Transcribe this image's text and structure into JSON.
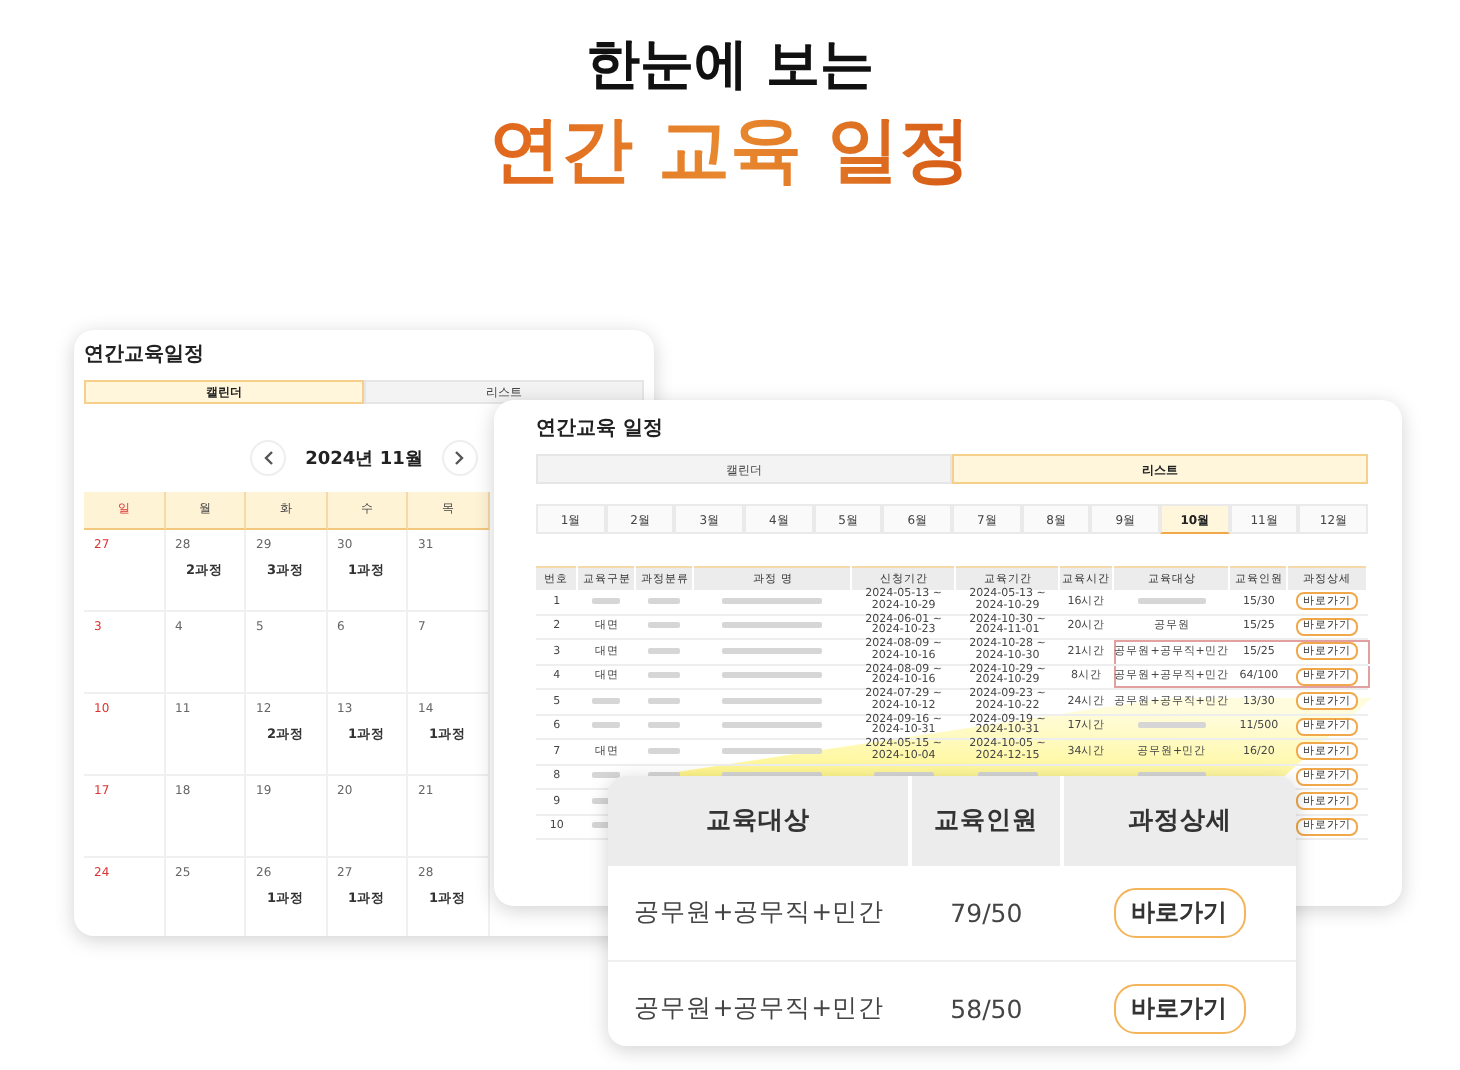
{
  "headline": {
    "line1": "한눈에 보는",
    "line2": "연간 교육 일정"
  },
  "calendar_window": {
    "title": "연간교육일정",
    "tabs": [
      {
        "label": "캘린더",
        "selected": true
      },
      {
        "label": "리스트",
        "selected": false
      }
    ],
    "month": "2024년 11월",
    "weekdays": [
      {
        "label": "일",
        "holiday": true
      },
      {
        "label": "월",
        "holiday": false
      },
      {
        "label": "화",
        "holiday": false
      },
      {
        "label": "수",
        "holiday": false
      },
      {
        "label": "목",
        "holiday": false
      }
    ],
    "weeks": [
      [
        {
          "day": "27",
          "holiday": true
        },
        {
          "day": "28",
          "holiday": false,
          "event": "2과정"
        },
        {
          "day": "29",
          "holiday": false,
          "event": "3과정"
        },
        {
          "day": "30",
          "holiday": false,
          "event": "1과정"
        },
        {
          "day": "31",
          "holiday": false
        }
      ],
      [
        {
          "day": "3",
          "holiday": true
        },
        {
          "day": "4",
          "holiday": false
        },
        {
          "day": "5",
          "holiday": false
        },
        {
          "day": "6",
          "holiday": false
        },
        {
          "day": "7",
          "holiday": false
        }
      ],
      [
        {
          "day": "10",
          "holiday": true
        },
        {
          "day": "11",
          "holiday": false
        },
        {
          "day": "12",
          "holiday": false,
          "event": "2과정"
        },
        {
          "day": "13",
          "holiday": false,
          "event": "1과정"
        },
        {
          "day": "14",
          "holiday": false,
          "event": "1과정"
        }
      ],
      [
        {
          "day": "17",
          "holiday": true
        },
        {
          "day": "18",
          "holiday": false
        },
        {
          "day": "19",
          "holiday": false
        },
        {
          "day": "20",
          "holiday": false
        },
        {
          "day": "21",
          "holiday": false
        }
      ],
      [
        {
          "day": "24",
          "holiday": true
        },
        {
          "day": "25",
          "holiday": false
        },
        {
          "day": "26",
          "holiday": false,
          "event": "1과정"
        },
        {
          "day": "27",
          "holiday": false,
          "event": "1과정"
        },
        {
          "day": "28",
          "holiday": false,
          "event": "1과정"
        }
      ]
    ]
  },
  "list_window": {
    "title": "연간교육 일정",
    "tabs": [
      {
        "label": "캘린더",
        "selected": false
      },
      {
        "label": "리스트",
        "selected": true
      }
    ],
    "months": [
      {
        "label": "1월",
        "selected": false
      },
      {
        "label": "2월",
        "selected": false
      },
      {
        "label": "3월",
        "selected": false
      },
      {
        "label": "4월",
        "selected": false
      },
      {
        "label": "5월",
        "selected": false
      },
      {
        "label": "6월",
        "selected": false
      },
      {
        "label": "7월",
        "selected": false
      },
      {
        "label": "8월",
        "selected": false
      },
      {
        "label": "9월",
        "selected": false
      },
      {
        "label": "10월",
        "selected": true
      },
      {
        "label": "11월",
        "selected": false
      },
      {
        "label": "12월",
        "selected": false
      }
    ],
    "table": {
      "columns": [
        "번호",
        "교육구분",
        "과정분류",
        "과정 명",
        "신청기간",
        "교육기간",
        "교육시간",
        "교육대상",
        "교육인원",
        "과정상세"
      ],
      "rows": [
        {
          "no": "1",
          "apply": "2024-05-13 ~ 2024-10-29",
          "period": "2024-05-13 ~ 2024-10-29",
          "hours": "16시간",
          "people": "15/30",
          "detail": "바로가기",
          "highlighted": false
        },
        {
          "no": "2",
          "type": "대면",
          "apply": "2024-06-01 ~ 2024-10-23",
          "period": "2024-10-30 ~ 2024-11-01",
          "hours": "20시간",
          "target": "공무원",
          "people": "15/25",
          "detail": "바로가기",
          "highlighted": false
        },
        {
          "no": "3",
          "type": "대면",
          "apply": "2024-08-09 ~ 2024-10-16",
          "period": "2024-10-28 ~ 2024-10-30",
          "hours": "21시간",
          "target": "공무원+공무직+민간",
          "people": "15/25",
          "detail": "바로가기",
          "highlighted": true
        },
        {
          "no": "4",
          "type": "대면",
          "apply": "2024-08-09 ~ 2024-10-16",
          "period": "2024-10-29 ~ 2024-10-29",
          "hours": "8시간",
          "target": "공무원+공무직+민간",
          "people": "64/100",
          "detail": "바로가기",
          "highlighted": true
        },
        {
          "no": "5",
          "apply": "2024-07-29 ~ 2024-10-12",
          "period": "2024-09-23 ~ 2024-10-22",
          "hours": "24시간",
          "target": "공무원+공무직+민간",
          "people": "13/30",
          "detail": "바로가기",
          "highlighted": false
        },
        {
          "no": "6",
          "apply": "2024-09-16 ~ 2024-10-31",
          "period": "2024-09-19 ~ 2024-10-31",
          "hours": "17시간",
          "people": "11/500",
          "detail": "바로가기",
          "highlighted": false
        },
        {
          "no": "7",
          "type": "대면",
          "apply": "2024-05-15 ~ 2024-10-04",
          "period": "2024-10-05 ~ 2024-12-15",
          "hours": "34시간",
          "target": "공무원+민간",
          "people": "16/20",
          "detail": "바로가기",
          "highlighted": false
        },
        {
          "no": "8",
          "detail": "바로가기",
          "highlighted": false
        },
        {
          "no": "9",
          "detail": "바로가기",
          "highlighted": false
        },
        {
          "no": "10",
          "detail": "바로가기",
          "highlighted": false
        }
      ]
    }
  },
  "zoom_popup": {
    "columns": [
      "교육대상",
      "교육인원",
      "과정상세"
    ],
    "rows": [
      {
        "target": "공무원+공무직+민간",
        "people": "79/50",
        "detail": "바로가기"
      },
      {
        "target": "공무원+공무직+민간",
        "people": "58/50",
        "detail": "바로가기"
      }
    ]
  }
}
